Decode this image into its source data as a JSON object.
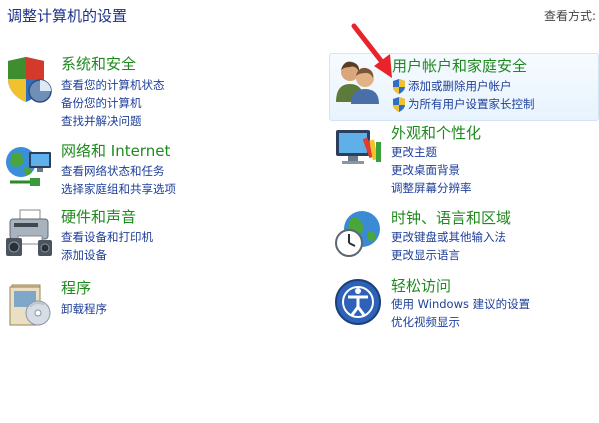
{
  "page": {
    "title": "调整计算机的设置",
    "view_by_label": "查看方式:"
  },
  "categories": [
    {
      "title": "系统和安全",
      "icon": "system-security-icon",
      "links": [
        "查看您的计算机状态",
        "备份您的计算机",
        "查找并解决问题"
      ]
    },
    {
      "title": "网络和 Internet",
      "icon": "network-internet-icon",
      "links": [
        "查看网络状态和任务",
        "选择家庭组和共享选项"
      ]
    },
    {
      "title": "硬件和声音",
      "icon": "hardware-sound-icon",
      "links": [
        "查看设备和打印机",
        "添加设备"
      ]
    },
    {
      "title": "程序",
      "icon": "programs-icon",
      "links": [
        "卸载程序"
      ]
    },
    {
      "title": "用户帐户和家庭安全",
      "icon": "user-accounts-icon",
      "links": [
        "添加或删除用户帐户",
        "为所有用户设置家长控制"
      ]
    },
    {
      "title": "外观和个性化",
      "icon": "appearance-icon",
      "links": [
        "更改主题",
        "更改桌面背景",
        "调整屏幕分辨率"
      ]
    },
    {
      "title": "时钟、语言和区域",
      "icon": "clock-language-region-icon",
      "links": [
        "更改键盘或其他输入法",
        "更改显示语言"
      ]
    },
    {
      "title": "轻松访问",
      "icon": "ease-of-access-icon",
      "links": [
        "使用 Windows 建议的设置",
        "优化视频显示"
      ]
    }
  ],
  "colors": {
    "category_title": "#1e8a1e",
    "link": "#1e3f9a",
    "page_title": "#1e3287",
    "highlight_bg": "#e8f3fd",
    "annotation_arrow": "#e8232a"
  }
}
